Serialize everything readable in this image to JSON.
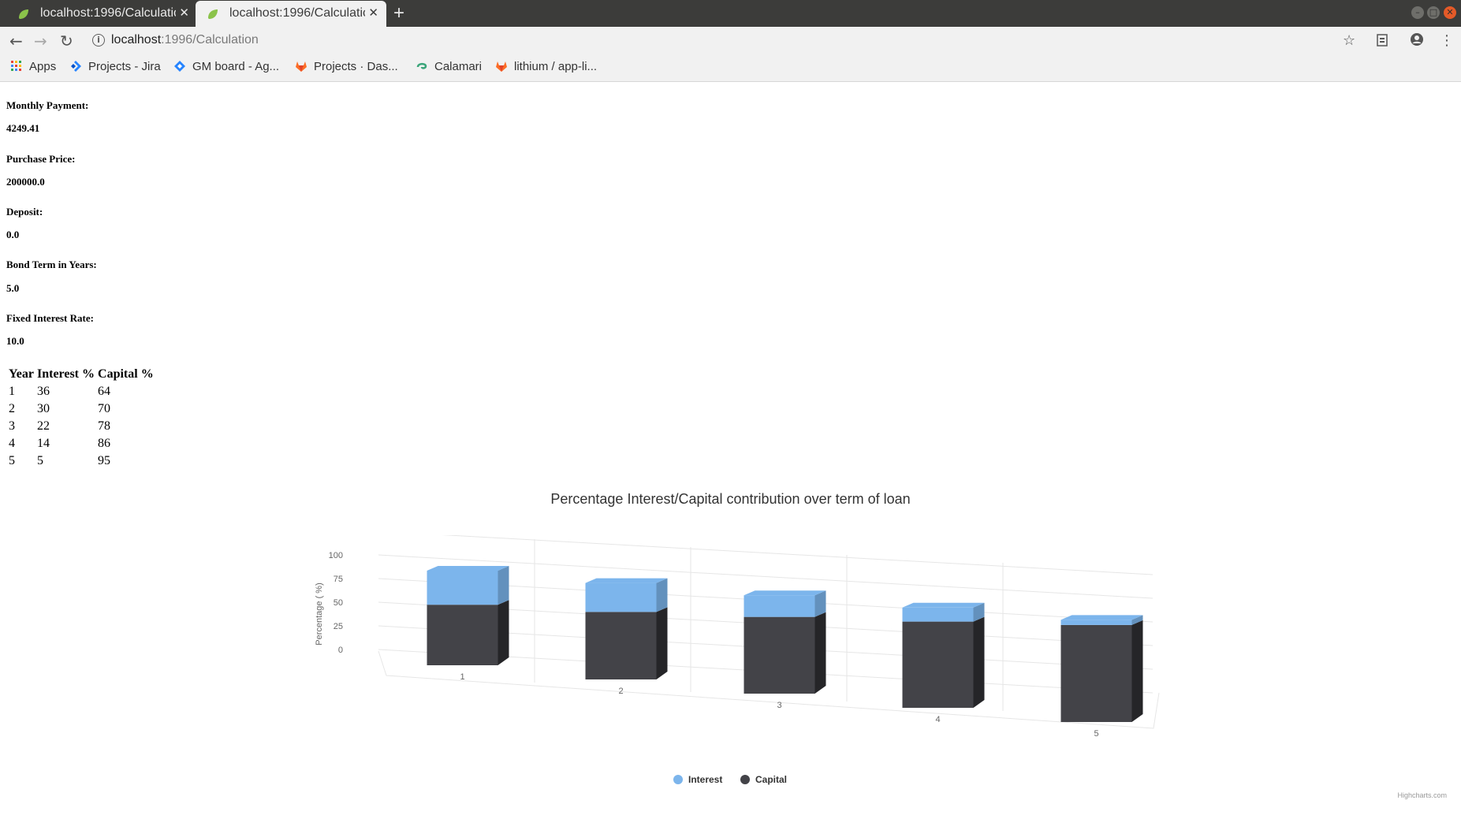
{
  "browser": {
    "tabs": [
      {
        "title": "localhost:1996/Calculation"
      },
      {
        "title": "localhost:1996/Calculation"
      }
    ],
    "url_host": "localhost",
    "url_path": ":1996/Calculation",
    "bookmarks": [
      {
        "label": "Apps",
        "icon": "apps-grid-icon"
      },
      {
        "label": "Projects - Jira",
        "icon": "jira-icon"
      },
      {
        "label": "GM board - Ag...",
        "icon": "jira-software-icon"
      },
      {
        "label": "Projects · Das...",
        "icon": "gitlab-icon"
      },
      {
        "label": "Calamari",
        "icon": "calamari-icon"
      },
      {
        "label": "lithium / app-li...",
        "icon": "gitlab-icon"
      }
    ]
  },
  "summary": {
    "monthly_payment_label": "Monthly Payment:",
    "monthly_payment": "4249.41",
    "purchase_price_label": "Purchase Price:",
    "purchase_price": "200000.0",
    "deposit_label": "Deposit:",
    "deposit": "0.0",
    "bond_term_label": "Bond Term in Years:",
    "bond_term": "5.0",
    "interest_rate_label": "Fixed Interest Rate:",
    "interest_rate": "10.0"
  },
  "table": {
    "headers": [
      "Year",
      "Interest %",
      "Capital %"
    ],
    "rows": [
      [
        "1",
        "36",
        "64"
      ],
      [
        "2",
        "30",
        "70"
      ],
      [
        "3",
        "22",
        "78"
      ],
      [
        "4",
        "14",
        "86"
      ],
      [
        "5",
        "5",
        "95"
      ]
    ]
  },
  "chart_data": {
    "type": "bar",
    "stacked": true,
    "three_d": true,
    "title": "Percentage Interest/Capital contribution over term of loan",
    "categories": [
      "1",
      "2",
      "3",
      "4",
      "5"
    ],
    "series": [
      {
        "name": "Interest",
        "values": [
          36,
          30,
          22,
          14,
          5
        ],
        "color": "#7cb5ec"
      },
      {
        "name": "Capital",
        "values": [
          64,
          70,
          78,
          86,
          95
        ],
        "color": "#434348"
      }
    ],
    "ylabel": "Percentage ( %)",
    "ylim": [
      0,
      125
    ],
    "yticks": [
      "0",
      "25",
      "50",
      "75",
      "100",
      "125"
    ],
    "grid": true,
    "legend_position": "bottom-center",
    "credits": "Highcharts.com"
  }
}
